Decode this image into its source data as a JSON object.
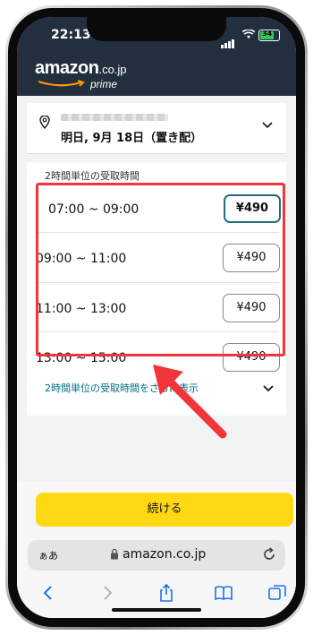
{
  "status_bar": {
    "time": "22:13",
    "battery": "34"
  },
  "header": {
    "logo_main": "amazon",
    "logo_tld": ".co.jp",
    "logo_sub": "prime"
  },
  "address_card": {
    "delivery_date": "明日, 9月 18日（置き配）"
  },
  "slots": {
    "section_title": "2時間単位の受取時間",
    "items": [
      {
        "time": "07:00 ~ 09:00",
        "price": "¥490",
        "selected": true
      },
      {
        "time": "09:00 ~ 11:00",
        "price": "¥490",
        "selected": false
      },
      {
        "time": "11:00 ~ 13:00",
        "price": "¥490",
        "selected": false
      },
      {
        "time": "13:00 ~ 15:00",
        "price": "¥490",
        "selected": false
      }
    ],
    "more_link": "2時間単位の受取時間をさらに表示"
  },
  "cta": {
    "continue_label": "続ける"
  },
  "browser": {
    "text_size_label": "ぁあ",
    "url": "amazon.co.jp"
  },
  "colors": {
    "accent_yellow": "#ffd814",
    "annotation_red": "#f2353a",
    "selected_border": "#1f6d7a",
    "selected_bar": "#23a33a"
  },
  "icons": [
    "location-pin-icon",
    "chevron-down-icon",
    "lock-icon",
    "reload-icon",
    "back-icon",
    "forward-icon",
    "share-icon",
    "bookmarks-icon",
    "tabs-icon"
  ]
}
